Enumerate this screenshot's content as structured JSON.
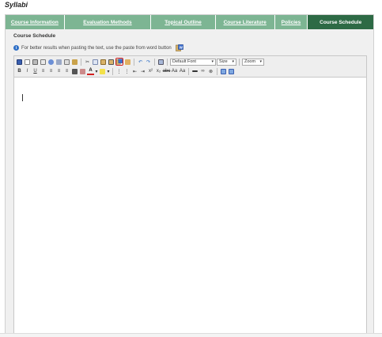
{
  "page": {
    "title": "Syllabi"
  },
  "tabs": [
    {
      "label": "Course Information",
      "active": false
    },
    {
      "label": "Evaluation Methods",
      "active": false
    },
    {
      "label": "Topical Outline",
      "active": false
    },
    {
      "label": "Course Literature",
      "active": false
    },
    {
      "label": "Policies",
      "active": false
    },
    {
      "label": "Course Schedule",
      "active": true
    }
  ],
  "section": {
    "title": "Course Schedule",
    "hint": "For better results when pasting the text, use the paste from word button"
  },
  "toolbar": {
    "font_select": "Default Font",
    "size_select": "Size",
    "zoom_select": "Zoom",
    "highlighted_button": "paste-from-word"
  },
  "colors": {
    "tab": "#7db593",
    "tab_active": "#2d6a45",
    "highlight": "#d21f1f"
  }
}
